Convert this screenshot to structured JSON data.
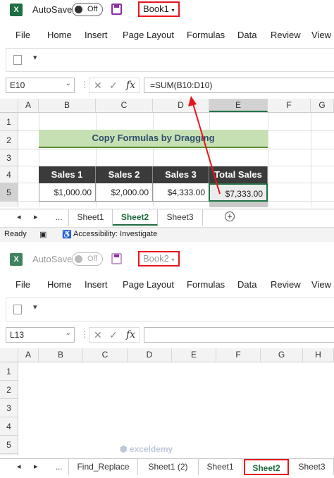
{
  "windows": [
    {
      "app_icon": "X",
      "autosave_label": "AutoSave",
      "toggle_text": "Off",
      "book_name": "Book1",
      "menu": [
        "File",
        "Home",
        "Insert",
        "Page Layout",
        "Formulas",
        "Data",
        "Review",
        "View"
      ],
      "name_box": "E10",
      "formula": "=SUM(B10:D10)",
      "columns": [
        "A",
        "B",
        "C",
        "D",
        "E",
        "F",
        "G"
      ],
      "rows": [
        "1",
        "2",
        "3",
        "4",
        "5"
      ],
      "banner": "Copy Formulas by Dragging",
      "headers": [
        "Sales 1",
        "Sales 2",
        "Sales 3",
        "Total Sales"
      ],
      "row5": [
        "$1,000.00",
        "$2,000.00",
        "$4,333.00",
        "$7,333.00"
      ],
      "tabs": [
        "...",
        "Sheet1",
        "Sheet2",
        "Sheet3"
      ],
      "active_tab": "Sheet2",
      "status": {
        "ready": "Ready",
        "accessibility": "Accessibility: Investigate"
      }
    },
    {
      "app_icon": "X",
      "autosave_label": "AutoSave",
      "toggle_text": "Off",
      "book_name": "Book2",
      "menu": [
        "File",
        "Home",
        "Insert",
        "Page Layout",
        "Formulas",
        "Data",
        "Review",
        "View"
      ],
      "name_box": "L13",
      "formula": "",
      "columns": [
        "A",
        "B",
        "C",
        "D",
        "E",
        "F",
        "G",
        "H"
      ],
      "rows": [
        "1",
        "2",
        "3",
        "4",
        "5"
      ],
      "tabs": [
        "...",
        "Find_Replace",
        "Sheet1 (2)",
        "Sheet1",
        "Sheet2",
        "Sheet3"
      ],
      "active_tab": "Sheet2"
    }
  ],
  "watermark": "exceldemy",
  "colors": {
    "excel_green": "#1e6b3c",
    "highlight_red": "#e8141c",
    "banner_green": "#c6e0b4",
    "header_dark": "#3b3b3b"
  },
  "icons": [
    "excel-logo-icon",
    "save-icon",
    "paste-icon",
    "cancel-icon",
    "check-icon",
    "fx-icon",
    "add-sheet-icon",
    "accessibility-icon",
    "arrow-icon"
  ]
}
